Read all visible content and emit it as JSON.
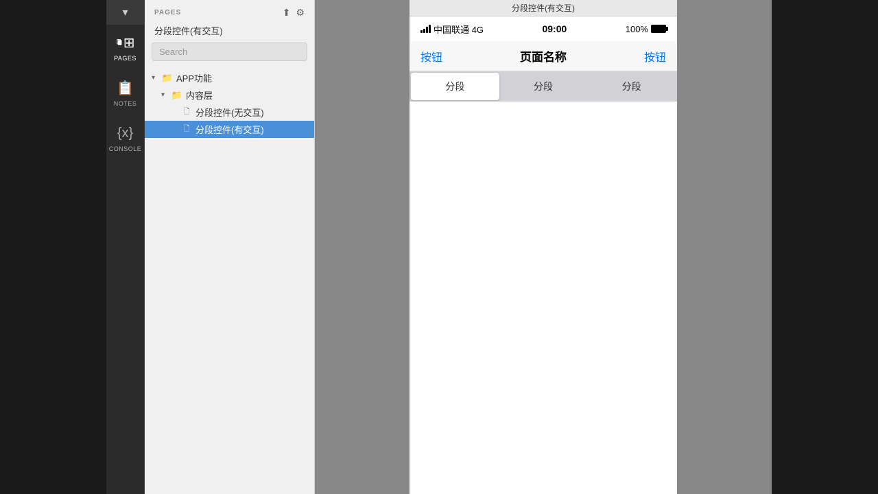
{
  "window": {
    "title": "分段控件(有交互)",
    "background": "#1a1a1a"
  },
  "icon_sidebar": {
    "dropdown_arrow": "▾",
    "items": [
      {
        "id": "pages",
        "label": "PAGES",
        "active": true
      },
      {
        "id": "notes",
        "label": "NOTES",
        "active": false
      },
      {
        "id": "console",
        "label": "CONSOLE",
        "active": false
      }
    ]
  },
  "pages_panel": {
    "section_label": "PAGES",
    "current_page": "分段控件(有交互)",
    "search_placeholder": "Search",
    "tree": {
      "root": {
        "label": "APP功能",
        "type": "folder",
        "expanded": true,
        "children": [
          {
            "label": "内容层",
            "type": "folder",
            "expanded": true,
            "children": [
              {
                "label": "分段控件(无交互)",
                "type": "page",
                "selected": false
              },
              {
                "label": "分段控件(有交互)",
                "type": "page",
                "selected": true
              }
            ]
          }
        ]
      }
    }
  },
  "mobile_preview": {
    "status_bar": {
      "carrier": "中国联通 4G",
      "time": "09:00",
      "battery": "100%"
    },
    "nav_bar": {
      "left_button": "按钮",
      "title": "页面名称",
      "right_button": "按钮"
    },
    "segmented_control": {
      "segments": [
        "分段",
        "分段",
        "分段"
      ],
      "active_index": 0
    }
  }
}
